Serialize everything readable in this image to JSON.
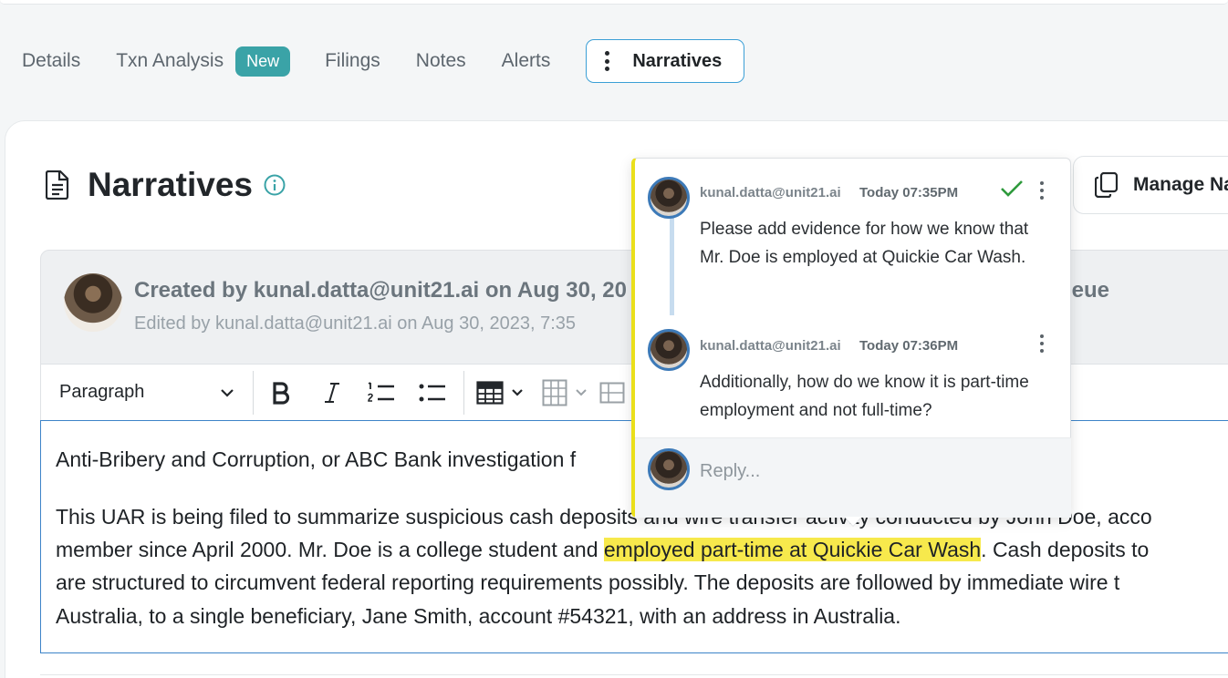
{
  "tabs": {
    "details": "Details",
    "txn_analysis": "Txn Analysis",
    "new_badge": "New",
    "filings": "Filings",
    "notes": "Notes",
    "alerts": "Alerts",
    "narratives": "Narratives"
  },
  "page": {
    "title": "Narratives",
    "manage_button": "Manage Na"
  },
  "narrative": {
    "created": "Created by kunal.datta@unit21.ai on Aug 30, 20",
    "edited": "Edited by kunal.datta@unit21.ai on Aug 30, 2023, 7:35",
    "queue_tail": "ueue"
  },
  "toolbar": {
    "paragraph_select": "Paragraph"
  },
  "editor": {
    "line1": "Anti-Bribery and Corruption, or ABC Bank investigation f",
    "line2": "This UAR is being filed to summarize suspicious cash deposits and wire transfer activity conducted by John Doe, acco",
    "line3_pre": "member since April 2000. Mr. Doe is a college student and ",
    "line3_highlight": "employed part-time at Quickie Car Wash",
    "line3_post": ". Cash deposits to",
    "line4": "are structured to circumvent federal reporting requirements possibly. The deposits are followed by immediate wire t",
    "line5": "Australia, to a single beneficiary, Jane Smith, account #54321, with an address in Australia."
  },
  "comments": [
    {
      "author": "kunal.datta@unit21.ai",
      "time": "Today 07:35PM",
      "body": "Please add evidence for how we know that Mr. Doe is employed at Quickie Car Wash.",
      "resolved_icon": "check-icon"
    },
    {
      "author": "kunal.datta@unit21.ai",
      "time": "Today 07:36PM",
      "body": "Additionally, how do we know it is part-time employment and not full-time?"
    }
  ],
  "reply": {
    "placeholder": "Reply..."
  },
  "colors": {
    "accent": "#3b9fd6",
    "badge": "#3aa3a7",
    "highlight": "#f7e94c",
    "resolved": "#2e9a3c"
  }
}
